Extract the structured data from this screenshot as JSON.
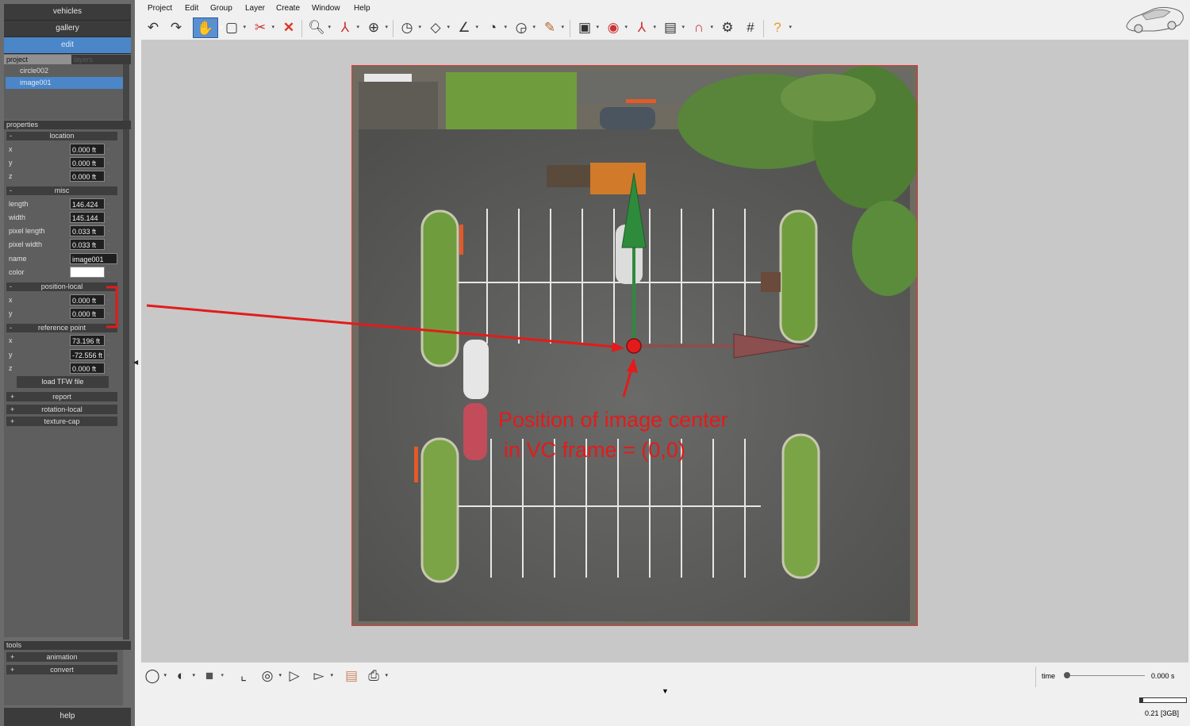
{
  "nav": {
    "vehicles": "vehicles",
    "gallery": "gallery",
    "edit": "edit"
  },
  "project_tabs": {
    "project": "project",
    "layers": "layers"
  },
  "project_items": [
    "circle002",
    "image001"
  ],
  "properties": {
    "header": "properties",
    "location": {
      "title": "location",
      "sign": "-",
      "x_label": "x",
      "x": "0.000 ft",
      "y_label": "y",
      "y": "0.000 ft",
      "z_label": "z",
      "z": "0.000 ft"
    },
    "misc": {
      "title": "misc",
      "sign": "-",
      "length_label": "length",
      "length": "146.424 ft",
      "width_label": "width",
      "width": "145.144 ft",
      "pixel_length_label": "pixel length",
      "pixel_length": "0.033 ft",
      "pixel_width_label": "pixel width",
      "pixel_width": "0.033 ft",
      "name_label": "name",
      "name": "image001",
      "color_label": "color",
      "color_value": "#ffffff"
    },
    "position_local": {
      "title": "position-local",
      "sign": "-",
      "x_label": "x",
      "x": "0.000 ft",
      "y_label": "y",
      "y": "0.000 ft"
    },
    "reference_point": {
      "title": "reference point",
      "sign": "-",
      "x_label": "x",
      "x": "73.196 ft",
      "y_label": "y",
      "y": "-72.556 ft",
      "z_label": "z",
      "z": "0.000 ft"
    },
    "load_tfw": "load TFW file",
    "folds": [
      {
        "sign": "+",
        "label": "report"
      },
      {
        "sign": "+",
        "label": "rotation-local"
      },
      {
        "sign": "+",
        "label": "texture-cap"
      }
    ]
  },
  "tools": {
    "header": "tools",
    "items": [
      {
        "sign": "+",
        "label": "animation"
      },
      {
        "sign": "+",
        "label": "convert"
      }
    ]
  },
  "help": "help",
  "menu": [
    "Project",
    "Edit",
    "Group",
    "Layer",
    "Create",
    "Window",
    "Help"
  ],
  "annotation": {
    "line1": "Position of image center",
    "line2": "in VC frame = (0,0)"
  },
  "status": {
    "time_label": "time",
    "time_value": "0.000 s",
    "memory": "0.21 [3GB]"
  },
  "colors": {
    "accent": "#4a86c8",
    "annotation": "#e31b1b",
    "axis_y": "#2e8b3c",
    "axis_x": "#8b4f4f"
  }
}
